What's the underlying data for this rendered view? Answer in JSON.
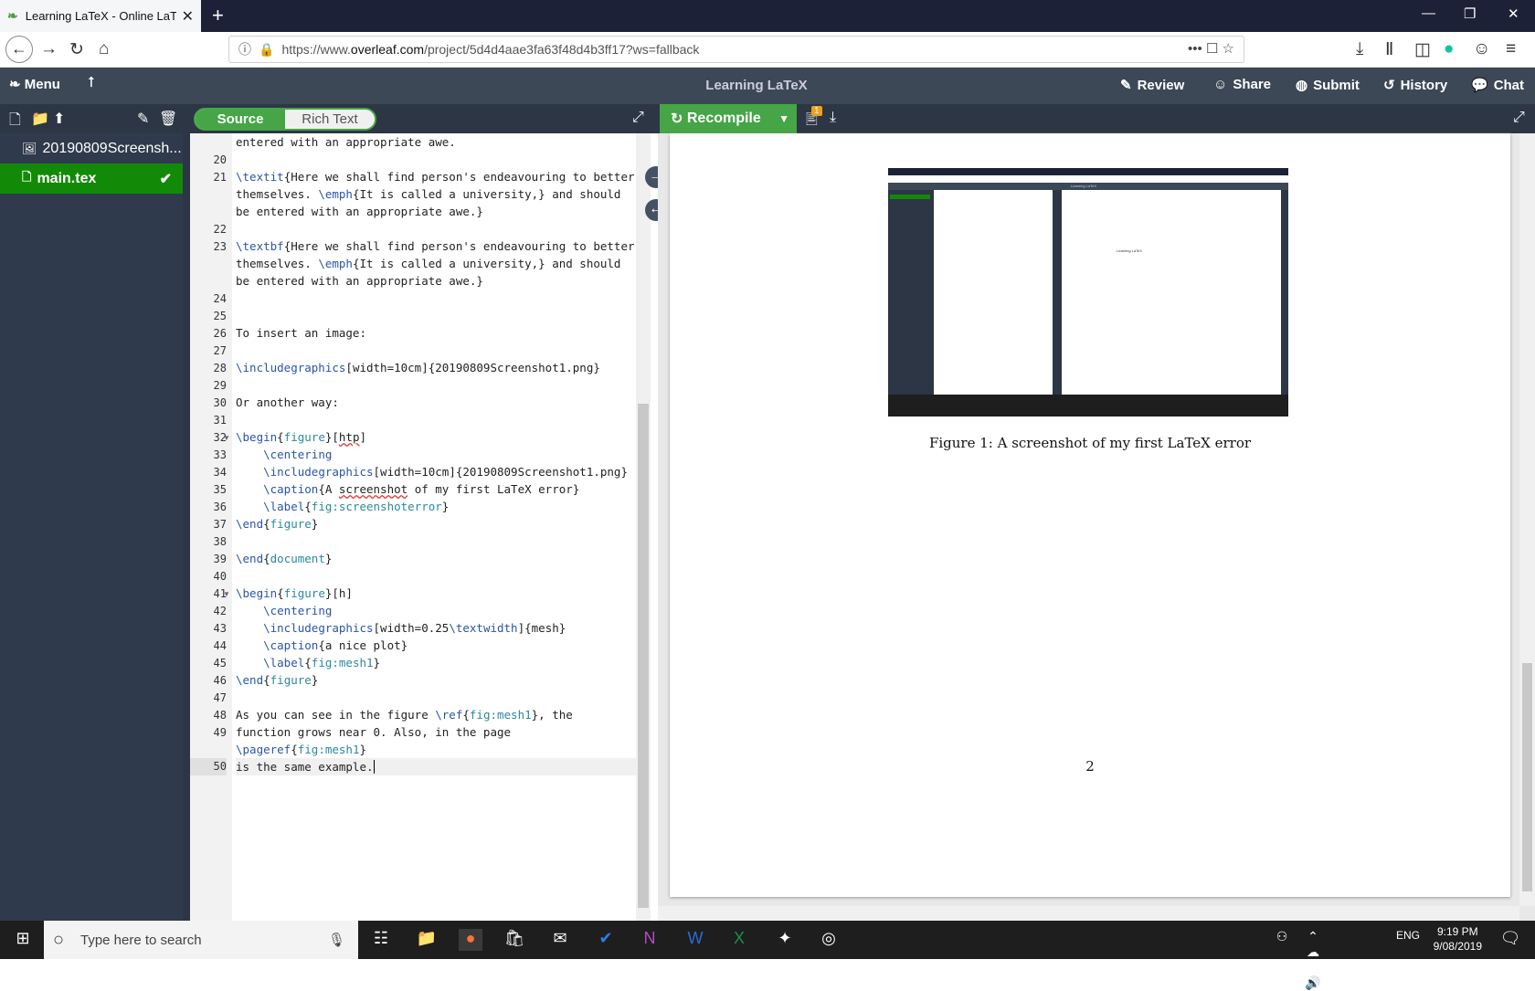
{
  "browser": {
    "tab_title": "Learning LaTeX - Online LaTeX",
    "url_prefix": "https://www.",
    "url_domain": "overleaf.com",
    "url_path": "/project/5d4d4aae3fa63f48d4b3ff17?ws=fallback"
  },
  "app": {
    "menu_label": "Menu",
    "project_title": "Learning LaTeX",
    "review": "Review",
    "share": "Share",
    "submit": "Submit",
    "history": "History",
    "chat": "Chat"
  },
  "toolbar": {
    "source": "Source",
    "rich_text": "Rich Text",
    "recompile": "Recompile",
    "log_badge": "1"
  },
  "files": [
    {
      "name": "20190809Screensh...",
      "type": "image"
    },
    {
      "name": "main.tex",
      "type": "tex",
      "selected": true
    }
  ],
  "code": {
    "partial_line": "entered with an appropriate awe."
  },
  "pdf": {
    "figure_caption": "Figure 1: A screenshot of my first LaTeX error",
    "page_number": "2",
    "inner_title": "Learning LaTeX",
    "inner_text": "Learning LaTeX"
  },
  "taskbar": {
    "search_placeholder": "Type here to search",
    "lang": "ENG",
    "time": "9:19 PM",
    "date": "9/08/2019"
  },
  "colors": {
    "overleaf_green": "#46a546",
    "dark_toolbar": "#3c4856",
    "sidebar": "#2f3a4c",
    "command": "#2a55a5",
    "argument": "#2a88a0"
  }
}
